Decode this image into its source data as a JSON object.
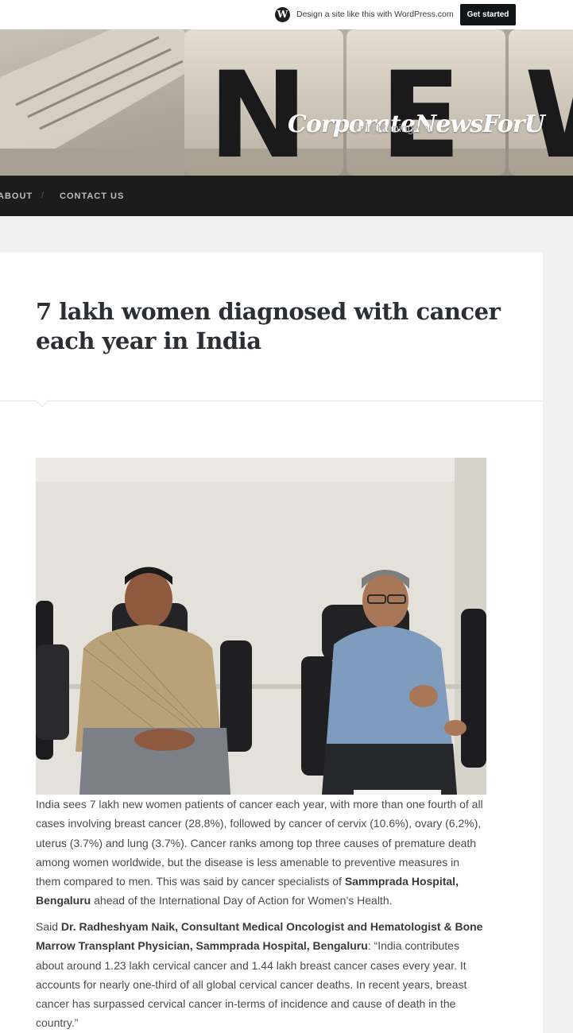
{
  "wpbar": {
    "logo_glyph": "W",
    "promo_text": "Design a site like this with WordPress.com",
    "cta_label": "Get started"
  },
  "site": {
    "title": "CorporateNewsForU",
    "tagline": "enlightening you",
    "header_letters": [
      "N",
      "E",
      "W"
    ]
  },
  "nav": {
    "items": [
      "ABOUT",
      "CONTACT US"
    ],
    "separator": "/"
  },
  "article": {
    "title": "7 lakh women diagnosed with cancer each year in India",
    "p1": {
      "t1": "India sees 7 lakh new women patients of cancer each year, with more than one fourth of all cases involving breast cancer (28.8%), followed by cancer of cervix (10.6%), ovary (6.2%), uterus (3.7%) and lung (3.7%). Cancer ranks among top three causes of premature death among women worldwide, but the disease is less amenable to preventive measures in them compared to men. This was said by cancer specialists of ",
      "b1": "Sammprada Hospital, Bengaluru",
      "t2": " ahead of the International Day of Action for Women’s Health."
    },
    "p2": {
      "t1": "Said ",
      "b1": "Dr. Radheshyam Naik, Consultant Medical Oncologist and Hematologist & Bone Marrow Transplant Physician, Sammprada Hospital, Bengaluru",
      "t2": ": “India contributes about around 1.23 lakh cervical cancer and 1.44 lakh breast cancer cases every year. It accounts for nearly one-third of all global cervical cancer deaths. In recent years, breast cancer has surpassed cervical cancer in-terms of incidence and cause of death in the country.”"
    }
  },
  "colors": {
    "nav_bg": "#1c1c1c",
    "title_text": "#2b2e33",
    "cta_bg": "#101517"
  }
}
